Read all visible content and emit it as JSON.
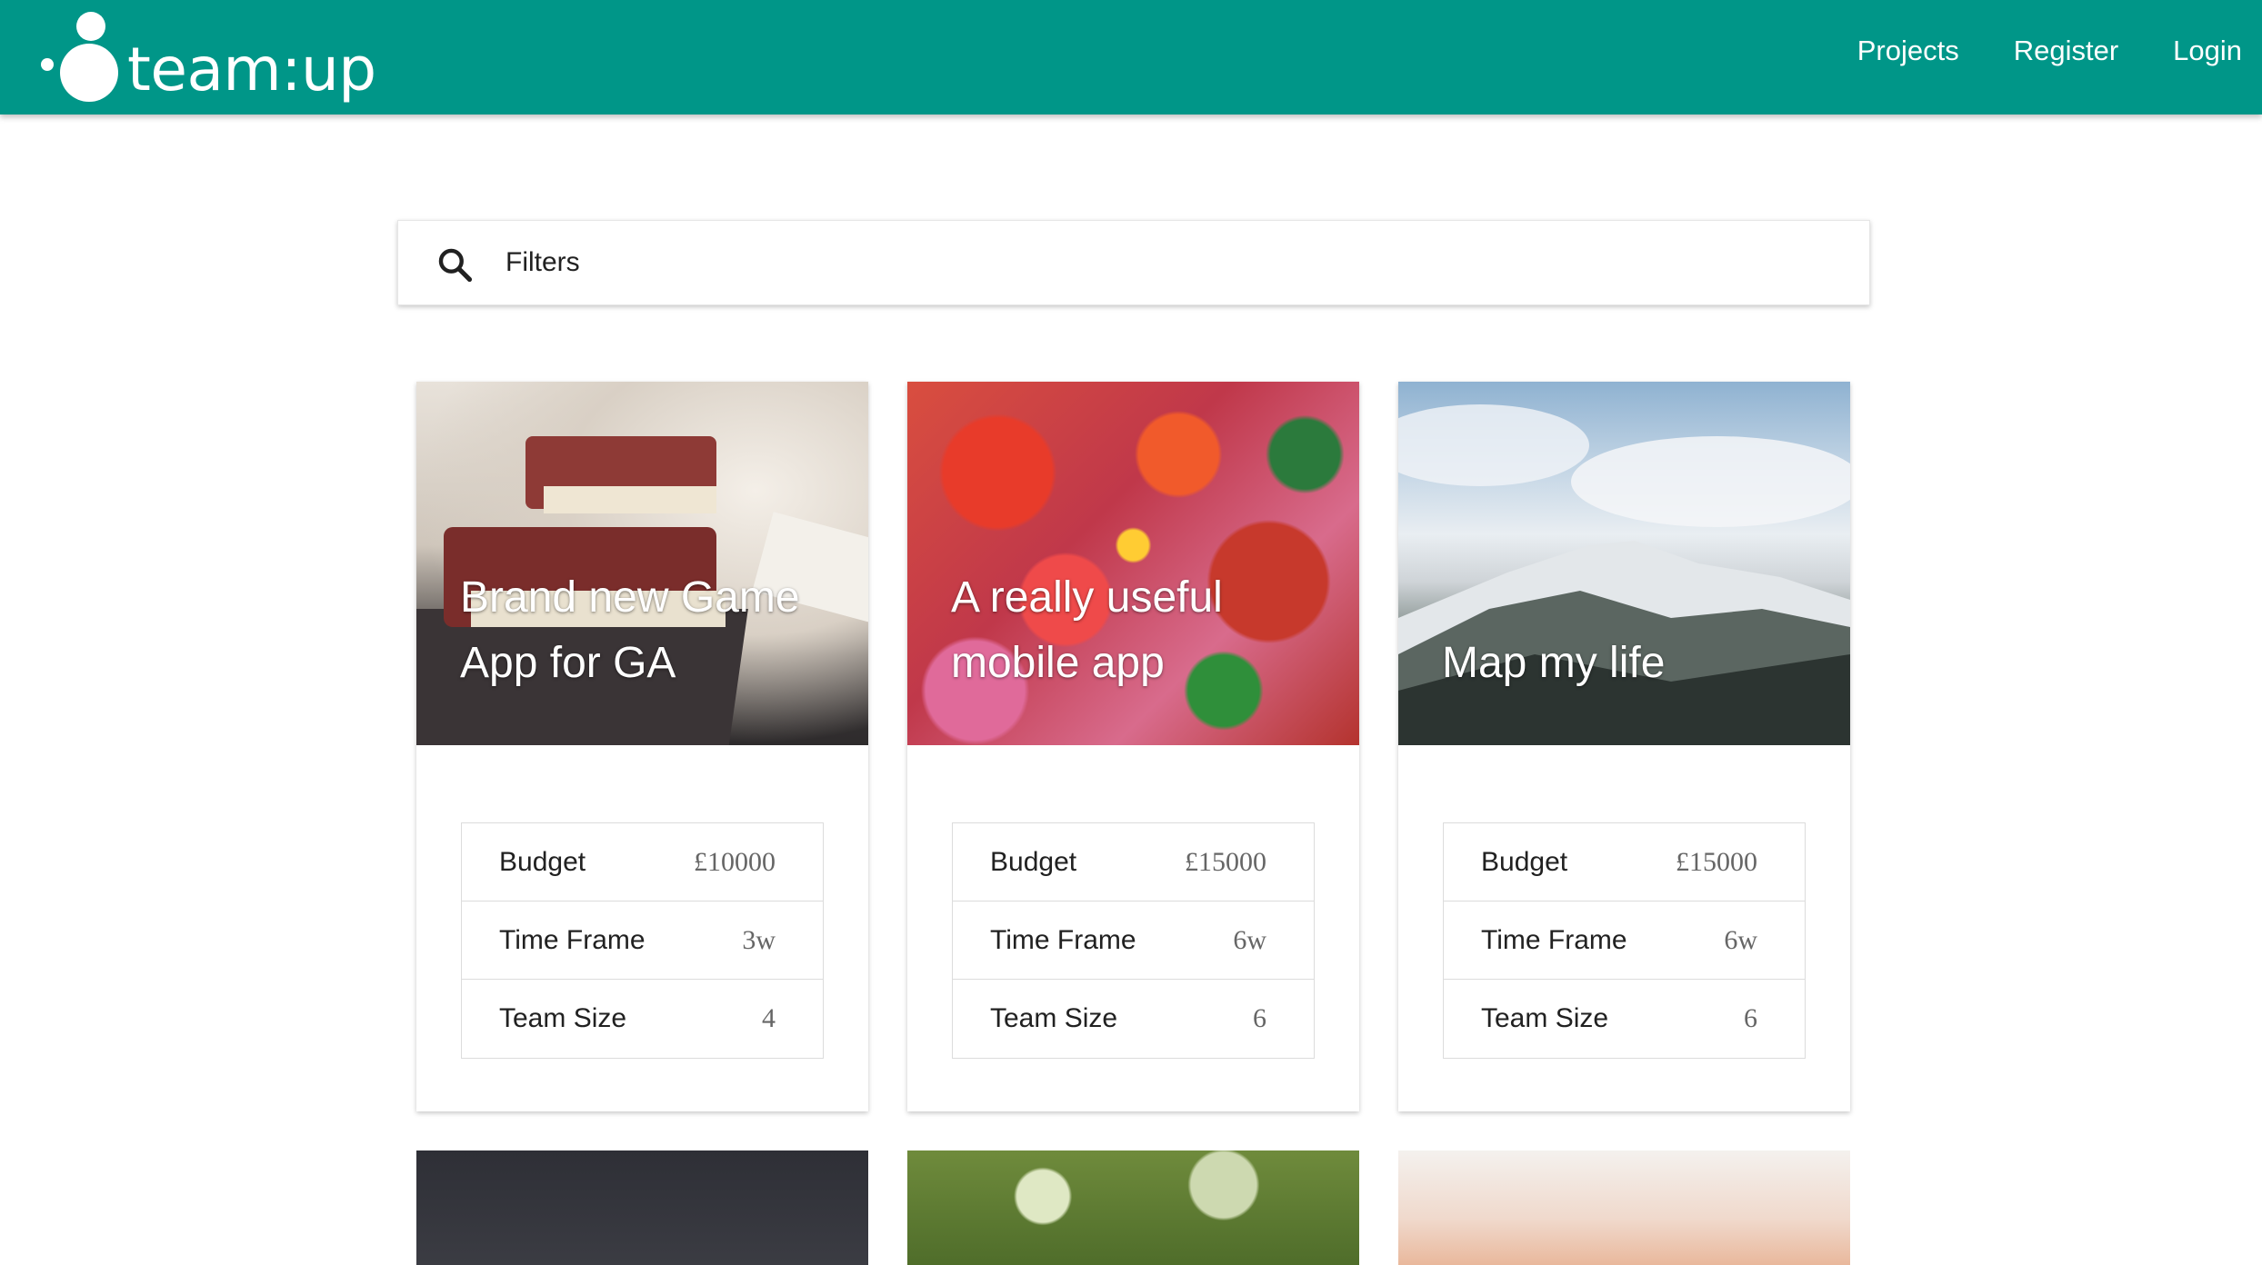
{
  "header": {
    "brand": "team:up",
    "nav": [
      "Projects",
      "Register",
      "Login"
    ],
    "background": "#009688"
  },
  "search": {
    "placeholder": "Filters",
    "icon": "search-icon"
  },
  "projects": [
    {
      "title": "Brand new Game App for GA",
      "image": "books-photo",
      "stats": [
        {
          "label": "Budget",
          "value": "£10000"
        },
        {
          "label": "Time Frame",
          "value": "3w"
        },
        {
          "label": "Team Size",
          "value": "4"
        }
      ]
    },
    {
      "title": "A really useful mobile app",
      "image": "graffiti-photo",
      "stats": [
        {
          "label": "Budget",
          "value": "£15000"
        },
        {
          "label": "Time Frame",
          "value": "6w"
        },
        {
          "label": "Team Size",
          "value": "6"
        }
      ]
    },
    {
      "title": "Map my life",
      "image": "mountain-photo",
      "stats": [
        {
          "label": "Budget",
          "value": "£15000"
        },
        {
          "label": "Time Frame",
          "value": "6w"
        },
        {
          "label": "Team Size",
          "value": "6"
        }
      ]
    }
  ],
  "more_projects": [
    {
      "image": "night-sky-photo"
    },
    {
      "image": "bokeh-leaves-photo"
    },
    {
      "image": "sunset-photo"
    }
  ]
}
